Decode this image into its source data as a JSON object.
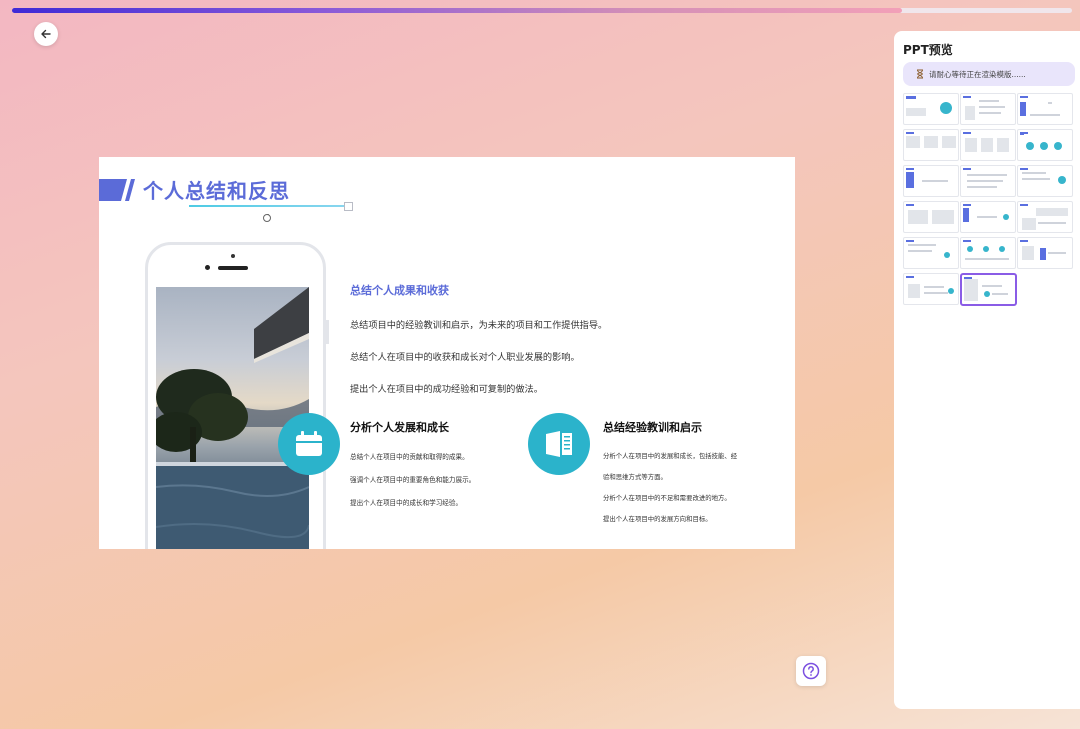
{
  "progress": {
    "percent": 84
  },
  "slide": {
    "title": "个人总结和反思",
    "section1": {
      "heading": "总结个人成果和收获",
      "lines": [
        "总结项目中的经验教训和启示，为未来的项目和工作提供指导。",
        "总结个人在项目中的收获和成长对个人职业发展的影响。",
        "提出个人在项目中的成功经验和可复制的做法。"
      ]
    },
    "section2": {
      "heading": "分析个人发展和成长",
      "lines": [
        "总结个人在项目中的贡献和取得的成果。",
        "强调个人在项目中的重要角色和能力展示。",
        "提出个人在项目中的成长和学习经验。"
      ]
    },
    "section3": {
      "heading": "总结经验教训和启示",
      "lines": [
        "分析个人在项目中的发展和成长，包括技能、经",
        "验和思维方式等方面。",
        "分析个人在项目中的不足和需要改进的地方。",
        "提出个人在项目中的发展方向和目标。"
      ]
    }
  },
  "panel": {
    "title": "PPT预览",
    "status": "请耐心等待正在渲染模版......",
    "thumbnail_count": 17,
    "selected_index": 16
  },
  "colors": {
    "accent": "#5b6bd8",
    "cyan": "#2bb3cb",
    "selected": "#8a5ce6"
  },
  "icons": {
    "back": "arrow-left-icon",
    "help": "question-circle-icon",
    "status": "hourglass-icon",
    "calendar": "calendar-icon",
    "book": "book-icon"
  }
}
